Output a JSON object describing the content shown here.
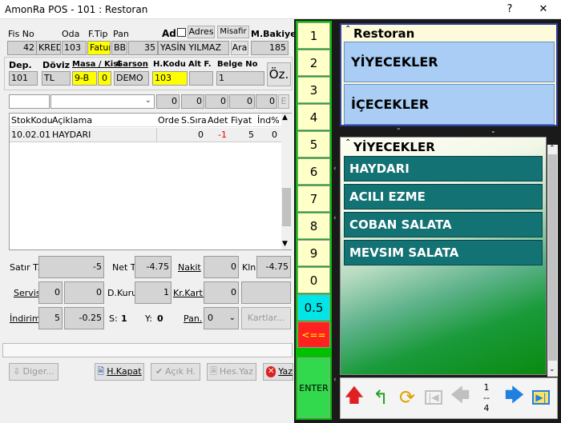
{
  "window": {
    "title": "AmonRa POS - 101 : Restoran",
    "help": "?",
    "close": "✕"
  },
  "header": {
    "fis_no_label": "Fis No",
    "oda_label": "Oda",
    "ftip_label": "F.Tip",
    "pan_label": "Pan",
    "adi_label": "Adi",
    "adres_button": "Adres",
    "misafir_button": "Misafir",
    "mbakiye_label": "M.Bakiye",
    "fis_no": "42",
    "kredi": "KRED",
    "oda": "103",
    "ftip": "Fatur",
    "pan": "BB",
    "pan_no": "35",
    "adi": "YASİN YILMAZ",
    "ara_button": "Ara",
    "mbakiye": "185",
    "dep_label": "Dep.",
    "doviz_label": "Döviz",
    "masa_label": "Masa / Kisi",
    "garson_label": "Garson",
    "hkodu_label": "H.Kodu",
    "altf_label": "Alt F.",
    "belgeno_label": "Belge No",
    "dep": "101",
    "doviz": "TL",
    "masa": "9-B",
    "kisi": "0",
    "garson": "DEMO",
    "hkodu": "103",
    "altf": "",
    "belgeno": "1",
    "oz_button": "Öz."
  },
  "filter": {
    "z1": "0",
    "z2": "0",
    "z3": "0",
    "z4": "0",
    "z5": "0",
    "e": "E"
  },
  "table": {
    "headers": [
      "StokKodu",
      "Açiklama",
      "Order",
      "S.Sıra",
      "Adet",
      "Fiyat",
      "İnd%"
    ],
    "rows": [
      {
        "stok": "10.02.01",
        "aciklama": "HAYDARI",
        "order": "",
        "sira": "0",
        "adet": "-1",
        "fiyat": "5",
        "ind": "0"
      }
    ]
  },
  "totals": {
    "satir_label": "Satır T.",
    "satir": "-5",
    "net_label": "Net T.",
    "net": "-4.75",
    "nakit_label": "Nakit",
    "nakit": "0",
    "kln_label": "Kln",
    "kln": "-4.75",
    "servis_label": "Servis",
    "servis1": "0",
    "servis2": "0",
    "dkuru_label": "D.Kuru",
    "dkuru": "1",
    "krkarti_label": "Kr.Karti",
    "krkarti": "0",
    "indirim_label": "İndirim",
    "indirim1": "5",
    "indirim2": "-0.25",
    "s_label": "S:",
    "s_val": "1",
    "y_label": "Y:",
    "y_val": "0",
    "pan_label": "Pan.",
    "pan_val": "0",
    "kartlar_button": "Kartlar..."
  },
  "bottom": {
    "diger": "Diger...",
    "hkapat": "H.Kapat",
    "acikh": "Açık H.",
    "hesyaz": "Hes.Yaz",
    "yaz": "Yaz"
  },
  "keypad": {
    "k1": "1",
    "k2": "2",
    "k3": "3",
    "k4": "4",
    "k5": "5",
    "k6": "6",
    "k7": "7",
    "k8": "8",
    "k9": "9",
    "k0": "0",
    "khalf": "0.5",
    "kback": "<==",
    "kenter": "ENTER"
  },
  "categories": {
    "title": "Restoran",
    "items": [
      "YİYECEKLER",
      "İÇECEKLER"
    ]
  },
  "products": {
    "title": "YİYECEKLER",
    "items": [
      "HAYDARI",
      "ACILI EZME",
      "COBAN SALATA",
      "MEVSIM SALATA"
    ]
  },
  "pager": {
    "page": "1",
    "sep": "--",
    "total": "4"
  },
  "colors": {
    "keypad_bg": "#ffffc8",
    "keypad_border_green": "#00c000",
    "half_bg": "#00e6e6",
    "back_bg": "#ff2020",
    "enter_bg": "#33d94d",
    "category_bg": "#a9cdf5",
    "product_bg": "#137273",
    "highlight_yellow": "#ffff00"
  }
}
